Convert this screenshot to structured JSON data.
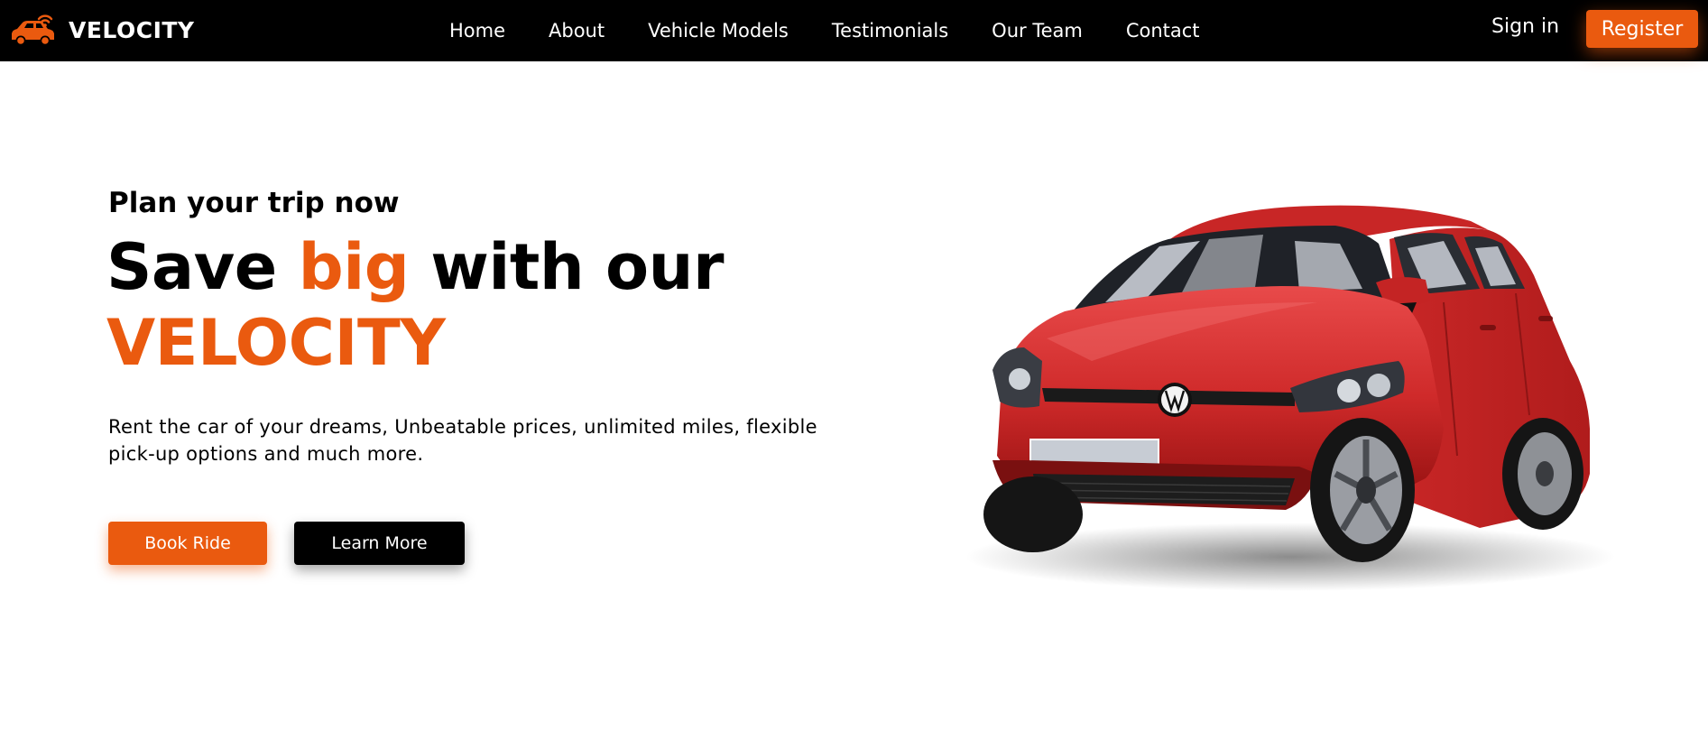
{
  "brand": {
    "name": "VELOCITY",
    "logo_icon": "car-wifi-icon"
  },
  "nav": {
    "links": [
      "Home",
      "About",
      "Vehicle Models",
      "Testimonials",
      "Our Team",
      "Contact"
    ],
    "sign_in": "Sign in",
    "register": "Register"
  },
  "hero": {
    "subtitle": "Plan your trip now",
    "title_part1": "Save ",
    "title_accent": "big",
    "title_part2": " with our",
    "title_line2": "VELOCITY",
    "description": "Rent the car of your dreams, Unbeatable prices, unlimited miles, flexible pick-up options and much more.",
    "book_button": "Book Ride",
    "learn_button": "Learn More",
    "image": "red-hatchback-car"
  },
  "colors": {
    "accent": "#ea5a0f",
    "nav_bg": "#000000",
    "background": "#ffffff",
    "car_red": "#d32b2b"
  }
}
